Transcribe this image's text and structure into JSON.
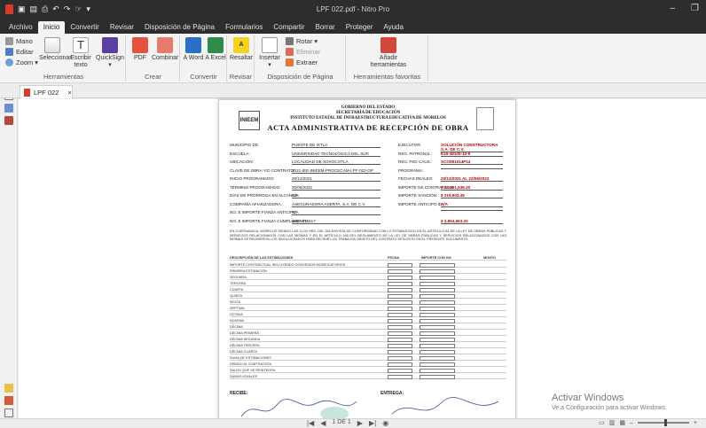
{
  "app": {
    "title": "LPF 022.pdf - Nitro Pro"
  },
  "colors": {
    "titlebar": "#2d2d2d",
    "ribbon": "#f3f3f3",
    "accent": "#d63b2a"
  },
  "menu": [
    "Archivo",
    "Inicio",
    "Convertir",
    "Revisar",
    "Disposición de Página",
    "Formularios",
    "Compartir",
    "Borrar",
    "Proteger",
    "Ayuda"
  ],
  "menu_active": "Inicio",
  "ribbon": {
    "herramientas": {
      "mano": "Mano",
      "editar": "Editar",
      "zoom": "Zoom ▾",
      "seleccionar": "Seleccionar",
      "escribir": "Escribir texto",
      "quicksign": "QuickSign ▾",
      "label": "Herramientas"
    },
    "crear": {
      "pdf": "PDF",
      "combinar": "Combinar",
      "label": "Crear"
    },
    "convertir": {
      "word": "A Word",
      "excel": "A Excel",
      "label": "Convertir"
    },
    "revisar": {
      "resaltar": "Resaltar",
      "label": "Revisar"
    },
    "disposicion": {
      "insertar": "Insertar ▾",
      "rotar": "Rotar ▾",
      "eliminar": "Eliminar",
      "extraer": "Extraer",
      "label": "Disposición de Página"
    },
    "favoritas": {
      "anadir": "Añadir herramientas",
      "label": "Herramientas favoritas"
    }
  },
  "tab": {
    "label": "LPF 022",
    "close": "×"
  },
  "document": {
    "org1": "GOBIERNO DEL ESTADO",
    "org2": "SECRETARÍA DE EDUCACIÓN",
    "org3": "INSTITUTO ESTATAL DE INFRAESTRUCTURA EDUCATIVA DE MORELOS",
    "heading": "ACTA   ADMINISTRATIVA DE RECEPCIÓN DE OBRA",
    "logo_text": "INIEEM",
    "fields": [
      {
        "label": "MUNICIPIO DE:",
        "value": "PUENTE DE IXTLA",
        "label2": "EJECUTOR:",
        "value2": "SOLUCIÓN CONSTRUCTORA S.A. DE C.V."
      },
      {
        "label": "ESCUELA:",
        "value": "UNIVERSIDAD TECNOLÓGICA DEL SUR",
        "label2": "REG. PATRONAL:",
        "value2": "E16-48100-10-9"
      },
      {
        "label": "UBICACIÓN:",
        "value": "LOCALIDAD DE XOXOCOTLA",
        "label2": "REG. FED CAUS.:",
        "value2": "SCO081014P14"
      },
      {
        "label": "CLAVE DE OBRA Y/O CONTRATO:",
        "value": "2021-IEE-INIEEM-PROCECAM-LPF-022-OP",
        "label2": "PROGRAMA:",
        "value2": ""
      },
      {
        "label": "INICIO PROGRAMADO:",
        "value": "20/12/2021",
        "label2": "FECHAS REALES:",
        "value2": "20/12/2021 AL 22/06/2022"
      },
      {
        "label": "TÉRMINO PROGRAMADO:",
        "value": "20/06/2022",
        "label2": "IMPORTE DE CONTRATADO:",
        "value2": "$ 22,461,536.20"
      },
      {
        "label": "DÍAS DE PRÓRROGA EN ALCANCE:",
        "value": "N/A",
        "label2": "IMPORTE SANCIÓN:",
        "value2": "$ 219,903.45"
      },
      {
        "label": "COMPAÑÍA AFIANZADORA:",
        "value": "ASEGURADORA ASERTA, S.A. DE C.V.",
        "label2": "IMPORTE ANTICIPO $:",
        "value2": "N/A"
      },
      {
        "label": "NO. E IMPORTE FIANZA ANTICIPO:",
        "value": "N/A",
        "label2": "",
        "value2": ""
      },
      {
        "label": "NO. E IMPORTE FIANZA CUMPLIMIENTO:",
        "value": "4607-011517",
        "label2": "",
        "value2": "$ 2,864,653.20"
      }
    ],
    "paragraph": "EN CUERNAVACA, MORELOS SIENDO LAS 11:00 HRS. DEL DÍA ENVISTA DE CONFORMIDAD CON LO ESTABLECIDO EN EL ARTÍCULO 64 DE LA LEY DE OBRAS PÚBLICAS Y SERVICIOS RELACIONADOS CON LAS MISMAS Y EN EL ARTÍCULO 166 DEL REGLAMENTO DE LA LEY DE OBRAS PÚBLICAS Y SERVICIOS RELACIONADOS CON LAS MISMAS SE REUNIERON LOS INVOLUCRADOS PARA RECIBIR LOS TRABAJOS OBJETO DEL CONTRATO DESCRITO EN EL PRESENTE DOCUMENTO.",
    "table_header": [
      "DESCRIPCIÓN DE LAS ESTIMACIONES",
      "FECHA",
      "IMPORTE CON IVA",
      "MONTO"
    ],
    "table_rows": [
      "IMPORTE CONTRACTUAL INCLUYENDO CONVENIOS MODIFICATORIOS",
      "PRIMERA ESTIMACIÓN",
      "SEGUNDA",
      "TERCERA",
      "CUARTA",
      "QUINTA",
      "SEXTA",
      "SÉPTIMA",
      "OCTAVA",
      "NOVENA",
      "DÉCIMA",
      "DÉCIMA PRIMERA",
      "DÉCIMA SEGUNDA",
      "DÉCIMA TERCERA",
      "DÉCIMA CUARTA",
      "SUMA DE ESTIMACIONES",
      "DEBIDO AL CONTRATISTA",
      "SALDO QUE SE REINTEGRA",
      "SUMAS IGUALES"
    ],
    "sign1": "RECIBE:",
    "sign2": "ENTREGA:"
  },
  "status": {
    "page_indicator": "1 DE 1",
    "watermark_title": "Activar Windows",
    "watermark_sub": "Ve a Configuración para activar Windows."
  }
}
